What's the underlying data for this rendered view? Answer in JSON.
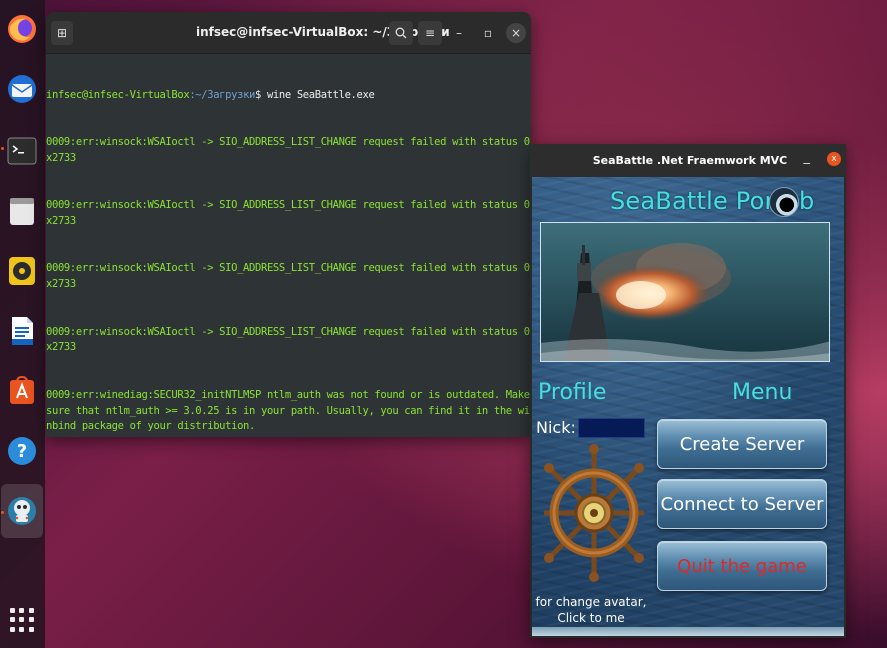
{
  "dock": {
    "items": [
      {
        "name": "firefox-icon"
      },
      {
        "name": "thunderbird-icon"
      },
      {
        "name": "terminal-icon"
      },
      {
        "name": "files-icon"
      },
      {
        "name": "rhythmbox-icon"
      },
      {
        "name": "libreoffice-writer-icon"
      },
      {
        "name": "software-center-icon"
      },
      {
        "name": "help-icon"
      },
      {
        "name": "wine-app-icon"
      }
    ],
    "accent_color": "#e95420"
  },
  "terminal": {
    "title": "infsec@infsec-VirtualBox: ~/Загрузки",
    "prompt_user": "infsec@infsec-VirtualBox",
    "prompt_path": ":~/Загрузки",
    "prompt_cmd": "$ wine SeaBattle.exe",
    "lines": [
      "0009:err:winsock:WSAIoctl -> SIO_ADDRESS_LIST_CHANGE request failed with status 0x2733",
      "0009:err:winsock:WSAIoctl -> SIO_ADDRESS_LIST_CHANGE request failed with status 0x2733",
      "0009:err:winsock:WSAIoctl -> SIO_ADDRESS_LIST_CHANGE request failed with status 0x2733",
      "0009:err:winsock:WSAIoctl -> SIO_ADDRESS_LIST_CHANGE request failed with status 0x2733",
      "0009:err:winediag:SECUR32_initNTLMSP ntlm_auth was not found or is outdated. Make sure that ntlm_auth >= 3.0.25 is in your path. Usually, you can find it in the winbind package of your distribution."
    ],
    "text_color": "#8ae234"
  },
  "seabattle": {
    "window_title": "SeaBattle .Net Fraemwork MVC",
    "minimize_glyph": "_",
    "close_glyph": "x",
    "heading": "SeaBattle Portab",
    "profile_label": "Profile",
    "menu_label": "Menu",
    "nick_label": "Nick:",
    "nick_value": "",
    "avatar_hint_line1": "for change avatar,",
    "avatar_hint_line2": "Click to me",
    "buttons": {
      "create_server": "Create Server",
      "connect_to_server": "Connect to Server",
      "quit": "Quit the game"
    },
    "heading_color": "#44e0e0",
    "quit_color": "#e02828"
  }
}
